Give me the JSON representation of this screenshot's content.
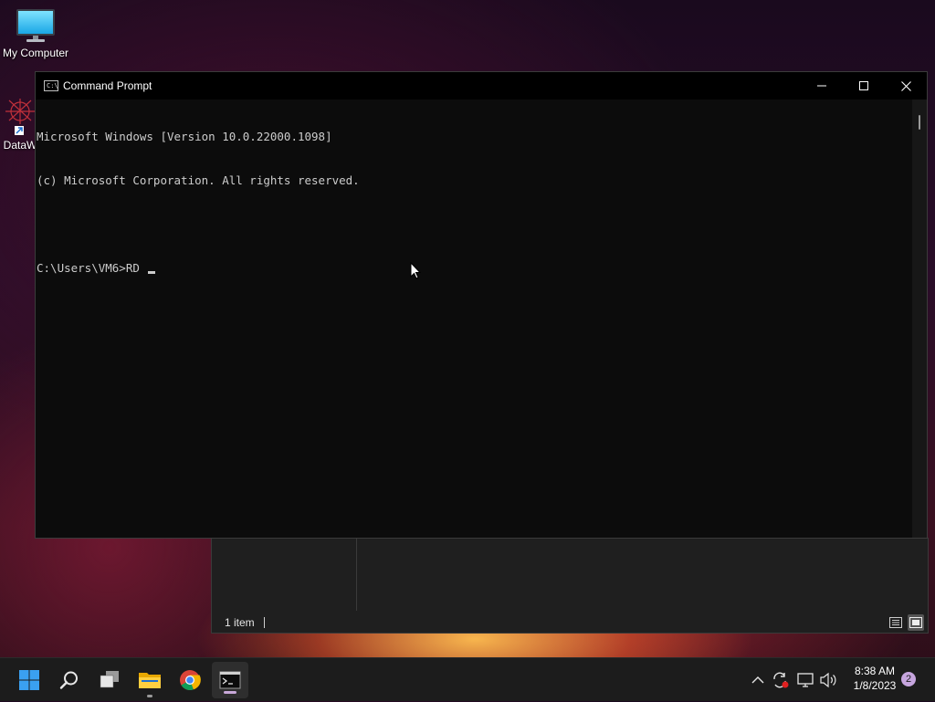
{
  "desktop": {
    "icons": [
      {
        "label": "My Computer"
      },
      {
        "label": "DataW"
      }
    ]
  },
  "explorer": {
    "status_text": "1 item"
  },
  "cmd": {
    "title": "Command Prompt",
    "icon_glyph": "C:\\",
    "lines": [
      "Microsoft Windows [Version 10.0.22000.1098]",
      "(c) Microsoft Corporation. All rights reserved.",
      "",
      "C:\\Users\\VM6>RD "
    ]
  },
  "taskbar": {
    "items": [
      "start-icon",
      "search-icon",
      "task-view-icon",
      "file-explorer-icon",
      "chrome-icon",
      "command-prompt-icon"
    ],
    "tray": [
      "chevron-up-icon",
      "sync-icon",
      "network-icon",
      "volume-icon"
    ],
    "time": "8:38 AM",
    "date": "1/8/2023",
    "notification_count": "2"
  },
  "colors": {
    "accent": "#c8a8d8",
    "console_bg": "#0c0c0c",
    "console_text": "#cccccc",
    "taskbar_bg": "#1c1c1c"
  }
}
